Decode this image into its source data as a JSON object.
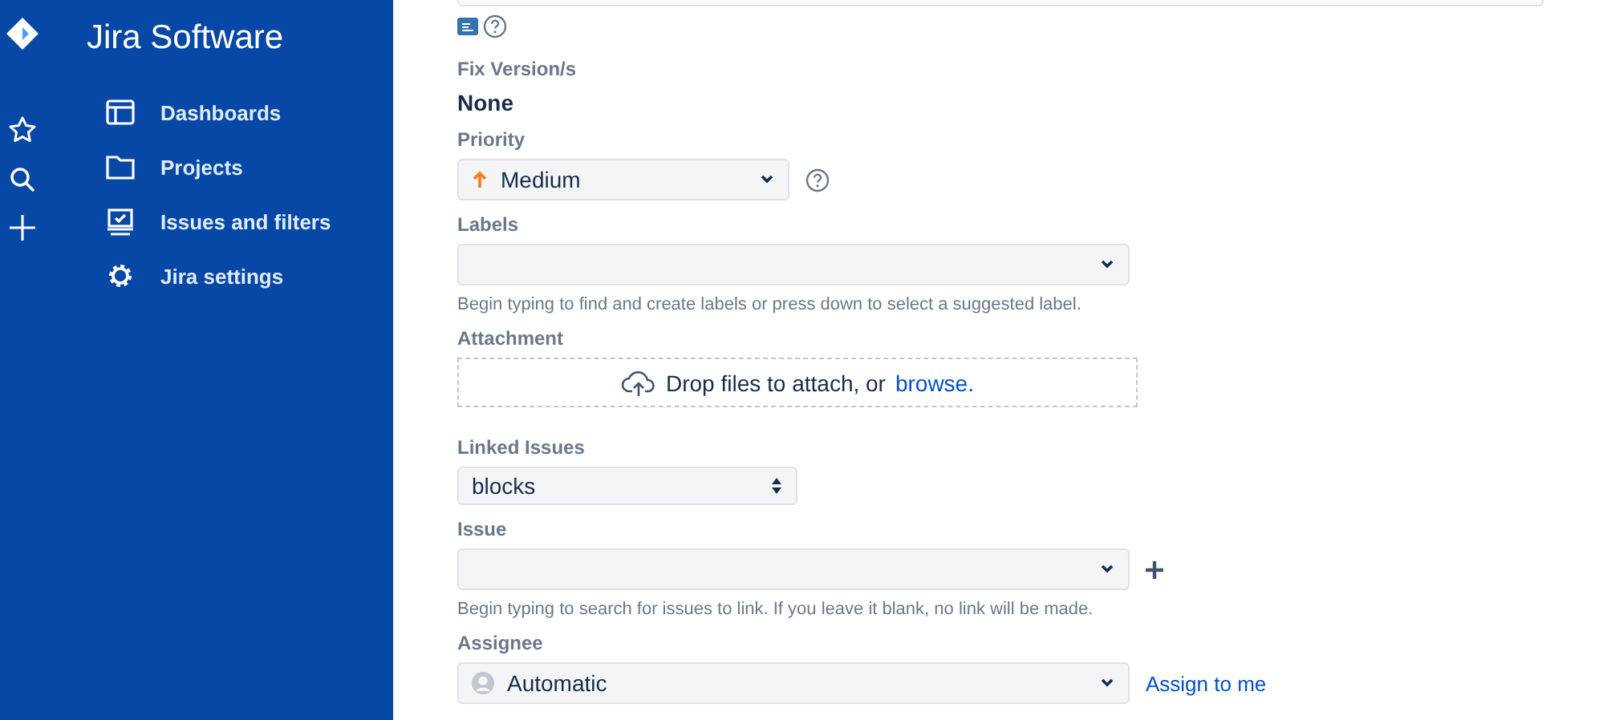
{
  "nav": {
    "title": "Jira Software",
    "items": [
      {
        "kind": "dashboards",
        "label": "Dashboards"
      },
      {
        "kind": "projects",
        "label": "Projects"
      },
      {
        "kind": "issues",
        "label": "Issues and filters"
      },
      {
        "kind": "settings",
        "label": "Jira settings"
      }
    ]
  },
  "fields": [
    {
      "kind": "static",
      "label": "Fix Version/s",
      "value": "None"
    },
    {
      "kind": "priority",
      "label": "Priority",
      "value": "Medium"
    },
    {
      "kind": "select",
      "label": "Labels",
      "hint": "Begin typing to find and create labels or press down to select a suggested label."
    },
    {
      "kind": "dropzone",
      "label": "Attachment",
      "value": "Drop files to attach, or",
      "link": "browse."
    },
    {
      "kind": "spinner",
      "label": "Linked Issues",
      "value": "blocks"
    },
    {
      "kind": "select-add",
      "label": "Issue",
      "hint": "Begin typing to search for issues to link. If you leave it blank, no link will be made."
    },
    {
      "kind": "assignee",
      "label": "Assignee",
      "value": "Automatic",
      "link": "Assign to me"
    }
  ]
}
